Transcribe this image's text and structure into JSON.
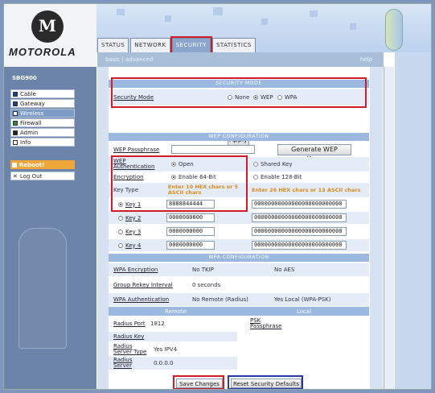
{
  "brand": {
    "name": "MOTOROLA",
    "model": "SBG900"
  },
  "tabs": [
    "STATUS",
    "NETWORK",
    "SECURITY",
    "STATISTICS"
  ],
  "subnav": {
    "basic": "basic",
    "sep": "|",
    "advanced": "advanced",
    "help": "help"
  },
  "sidebar": {
    "items": [
      "Cable",
      "Gateway",
      "Wireless",
      "Firewall",
      "Admin",
      "Info"
    ],
    "reboot": "Reboot!",
    "logout": "Log Out"
  },
  "security_mode": {
    "header": "SECURITY MODE",
    "label": "Security Mode",
    "options": [
      "None",
      "WEP",
      "WPA"
    ],
    "apply": "Apply"
  },
  "wep": {
    "header": "WEP CONFIGURATION",
    "passphrase_label": "WEP Passphrase",
    "passphrase_value": "",
    "generate": "Generate WEP Keys",
    "auth_label": "WEP Authentication",
    "auth_open": "Open",
    "auth_shared": "Shared Key",
    "enc_label": "Encryption",
    "enc_64": "Enable 64-Bit",
    "enc_128": "Enable 128-Bit",
    "key_type": "Key Type",
    "hint_64": "Enter 10 HEX chars or 5 ASCII chars",
    "hint_128": "Enter 26 HEX chars or 13 ASCII chars",
    "keys": [
      {
        "label": "Key 1",
        "v64": "8888844444",
        "v128": "00000000000000000000000000"
      },
      {
        "label": "Key 2",
        "v64": "0000000000",
        "v128": "00000000000000000000000000"
      },
      {
        "label": "Key 3",
        "v64": "0000000000",
        "v128": "00000000000000000000000000"
      },
      {
        "label": "Key 4",
        "v64": "0000000000",
        "v128": "00000000000000000000000000"
      }
    ]
  },
  "wpa": {
    "header": "WPA CONFIGURATION",
    "enc_label": "WPA Encryption",
    "enc_tkip": "No TKIP",
    "enc_aes": "No AES",
    "rekey_label": "Group Rekey Interval",
    "rekey_value": "0 seconds",
    "auth_label": "WPA Authentication",
    "auth_radius": "No Remote (Radius)",
    "auth_psk": "Yes Local (WPA-PSK)",
    "remote": "Remote",
    "local": "Local",
    "port_label": "Radius Port",
    "port_value": "1812",
    "psk_label": "PSK Passphrase",
    "key_label": "Radius Key",
    "server_type_label": "Radius Server Type",
    "server_type_value": "Yes IPV4",
    "server_label": "Radius Server",
    "server_value": "0.0.0.0"
  },
  "actions": {
    "save": "Save Changes",
    "reset": "Reset Security Defaults"
  },
  "colors": {
    "highlight_red": "#d21b2a",
    "highlight_blue": "#2a38a8",
    "section_blue": "#9bb8e0"
  }
}
